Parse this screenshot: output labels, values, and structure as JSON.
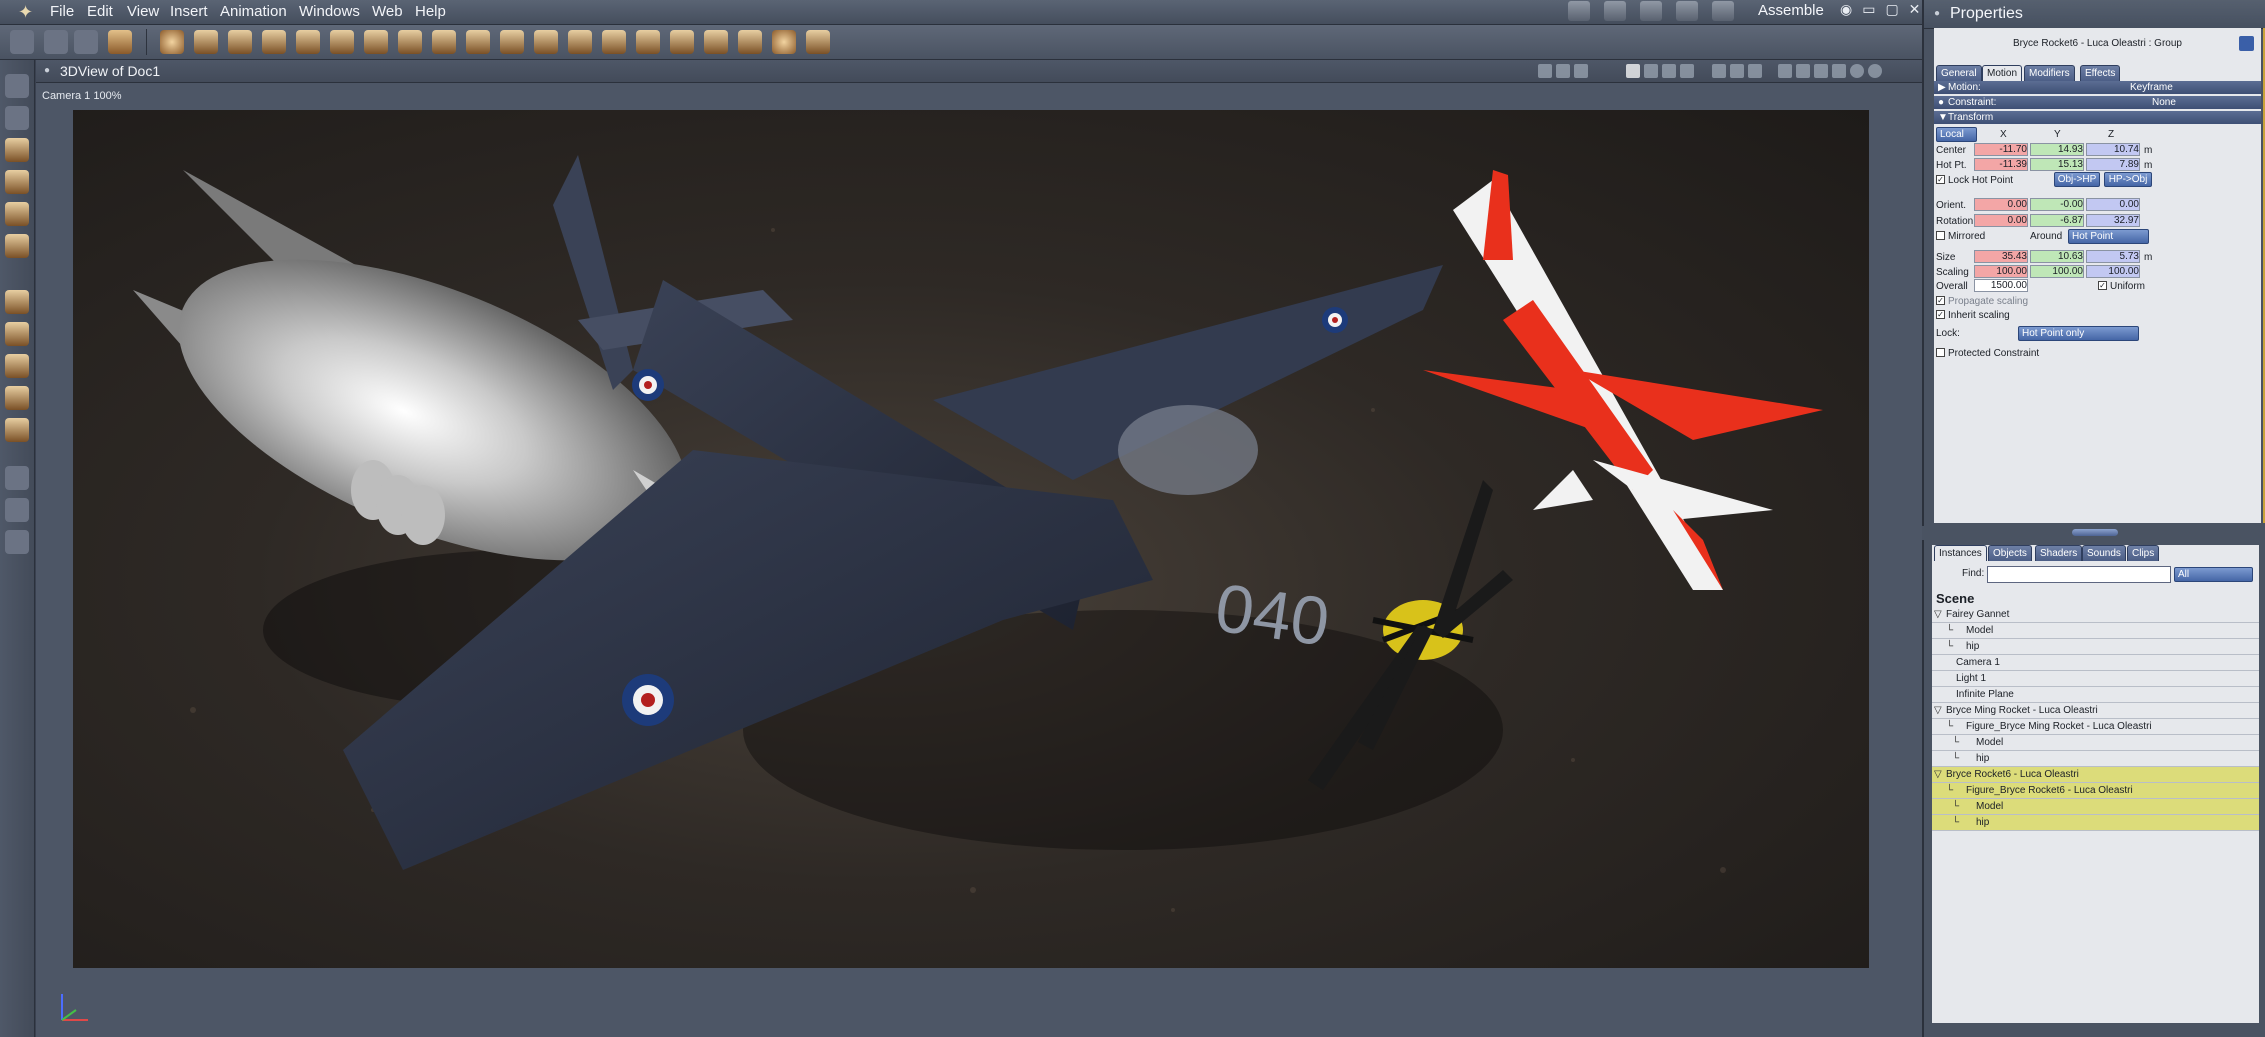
{
  "menubar": {
    "items": [
      "File",
      "Edit",
      "View",
      "Insert",
      "Animation",
      "Windows",
      "Web",
      "Help"
    ],
    "room": "Assemble"
  },
  "viewport": {
    "title": "3DView of Doc1",
    "camera_label": "Camera 1  100%",
    "render_text": "040"
  },
  "properties": {
    "title": "Properties",
    "object_name": "Bryce Rocket6 - Luca Oleastri : Group",
    "tabs": [
      "General",
      "Motion",
      "Modifiers",
      "Effects"
    ],
    "active_tab": "Motion",
    "motion_label": "Motion:",
    "motion_value": "Keyframe",
    "constraint_label": "Constraint:",
    "constraint_value": "None",
    "transform_label": "Transform",
    "space": "Local",
    "axes": [
      "X",
      "Y",
      "Z"
    ],
    "rows": [
      {
        "label": "Center",
        "x": "-11.70",
        "y": "14.93",
        "z": "10.74",
        "unit": "m"
      },
      {
        "label": "Hot Pt.",
        "x": "-11.39",
        "y": "15.13",
        "z": "7.89",
        "unit": "m"
      }
    ],
    "lock_hot_point": "Lock Hot Point",
    "obj_hp": "Obj->HP",
    "hp_obj": "HP->Obj",
    "orient": {
      "label": "Orient.",
      "x": "0.00",
      "y": "-0.00",
      "z": "0.00"
    },
    "rotation": {
      "label": "Rotation",
      "x": "0.00",
      "y": "-6.87",
      "z": "32.97"
    },
    "mirrored": "Mirrored",
    "around": "Around",
    "around_value": "Hot Point",
    "size": {
      "label": "Size",
      "x": "35.43",
      "y": "10.63",
      "z": "5.73",
      "unit": "m"
    },
    "scaling": {
      "label": "Scaling",
      "x": "100.00",
      "y": "100.00",
      "z": "100.00"
    },
    "overall": {
      "label": "Overall",
      "value": "1500.00"
    },
    "uniform": "Uniform",
    "propagate": "Propagate scaling",
    "inherit": "Inherit scaling",
    "lock_label": "Lock:",
    "lock_value": "Hot Point only",
    "protected": "Protected Constraint"
  },
  "scene": {
    "tabs": [
      "Instances",
      "Objects",
      "Shaders",
      "Sounds",
      "Clips"
    ],
    "active_tab": "Instances",
    "find_label": "Find:",
    "filter": "All",
    "heading": "Scene",
    "rows": [
      {
        "text": "Fairey Gannet",
        "indent": 0,
        "hl": false
      },
      {
        "text": "Model",
        "indent": 2,
        "hl": false
      },
      {
        "text": "hip",
        "indent": 2,
        "hl": false
      },
      {
        "text": "Camera 1",
        "indent": 1,
        "hl": false
      },
      {
        "text": "Light 1",
        "indent": 1,
        "hl": false
      },
      {
        "text": "Infinite Plane",
        "indent": 1,
        "hl": false
      },
      {
        "text": "Bryce Ming Rocket - Luca Oleastri",
        "indent": 0,
        "hl": false
      },
      {
        "text": "Figure_Bryce Ming Rocket - Luca Oleastri",
        "indent": 2,
        "hl": false
      },
      {
        "text": "Model",
        "indent": 3,
        "hl": false
      },
      {
        "text": "hip",
        "indent": 3,
        "hl": false
      },
      {
        "text": "Bryce Rocket6 - Luca Oleastri",
        "indent": 0,
        "hl": true
      },
      {
        "text": "Figure_Bryce Rocket6 - Luca Oleastri",
        "indent": 2,
        "hl": true
      },
      {
        "text": "Model",
        "indent": 3,
        "hl": true
      },
      {
        "text": "hip",
        "indent": 3,
        "hl": true
      }
    ]
  },
  "colors": {
    "x": "#f3a6a6",
    "y": "#bfe7b7",
    "z": "#c2c8f2",
    "highlight": "#dcdc7a",
    "tab": "#4c5e86"
  }
}
